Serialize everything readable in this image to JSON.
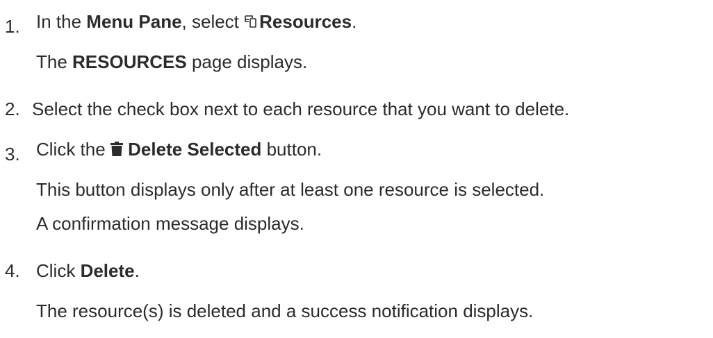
{
  "steps": [
    {
      "number": "1.",
      "parts": {
        "a": "In the ",
        "b": "Menu Pane",
        "c": ", select ",
        "d": "Resources",
        "e": "."
      },
      "icon": "resources-icon",
      "result": {
        "a": "The ",
        "b": "RESOURCES",
        "c": " page displays."
      }
    },
    {
      "number": "2.",
      "text": " Select the check box next to each resource that you want to delete."
    },
    {
      "number": "3.",
      "parts": {
        "a": "Click the ",
        "b": "Delete Selected",
        "c": " button."
      },
      "icon": "trash-icon",
      "notes": [
        "This button displays only after at least one resource is selected.",
        "A confirmation message displays."
      ]
    },
    {
      "number": "4.",
      "parts": {
        "a": "Click ",
        "b": "Delete",
        "c": "."
      },
      "result": "The resource(s) is deleted and a success notification displays."
    }
  ]
}
